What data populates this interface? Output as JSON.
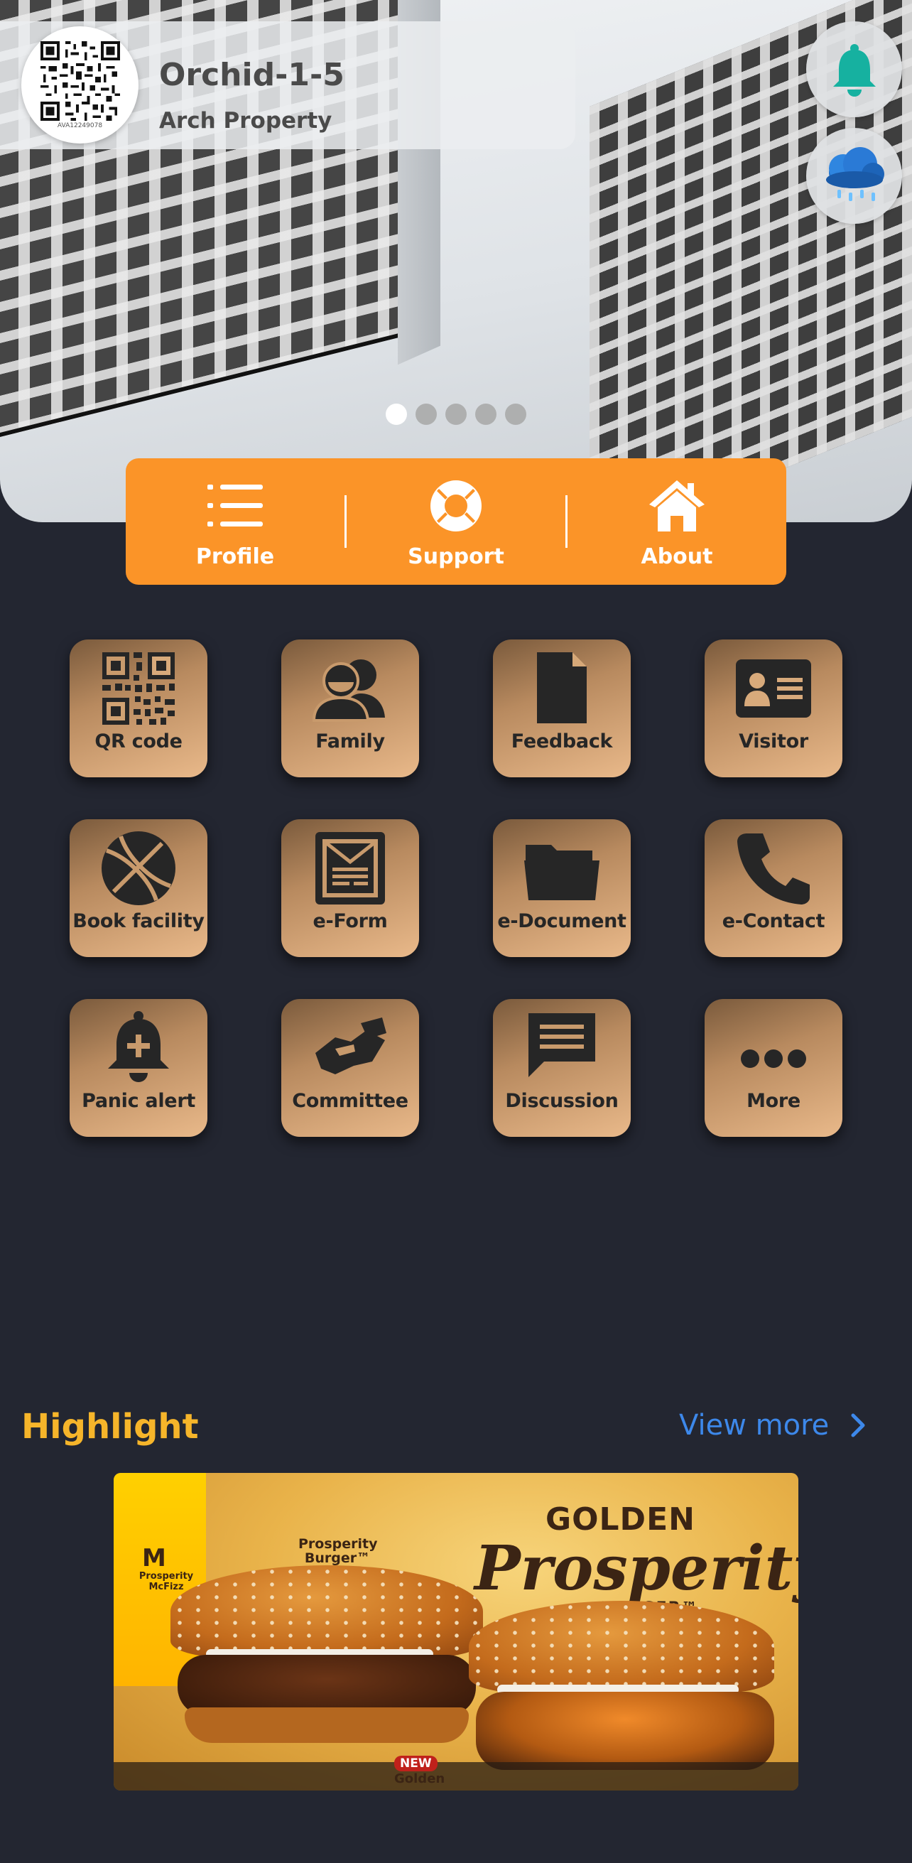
{
  "header": {
    "unit": "Orchid-1-5",
    "property": "Arch Property",
    "qr_caption": "AVA12249078"
  },
  "hero": {
    "slide_count": 5,
    "active_slide": 1
  },
  "nav": [
    {
      "label": "Profile",
      "icon": "list-icon"
    },
    {
      "label": "Support",
      "icon": "lifebuoy-icon"
    },
    {
      "label": "About",
      "icon": "home-icon"
    }
  ],
  "grid": [
    {
      "label": "QR code",
      "icon": "qr-code-icon"
    },
    {
      "label": "Family",
      "icon": "family-icon"
    },
    {
      "label": "Feedback",
      "icon": "document-icon"
    },
    {
      "label": "Visitor",
      "icon": "id-card-icon"
    },
    {
      "label": "Book facility",
      "icon": "basketball-icon"
    },
    {
      "label": "e-Form",
      "icon": "form-icon"
    },
    {
      "label": "e-Document",
      "icon": "folder-icon"
    },
    {
      "label": "e-Contact",
      "icon": "phone-icon"
    },
    {
      "label": "Panic alert",
      "icon": "alert-bell-icon"
    },
    {
      "label": "Committee",
      "icon": "handshake-icon"
    },
    {
      "label": "Discussion",
      "icon": "chat-icon"
    },
    {
      "label": "More",
      "icon": "more-icon"
    }
  ],
  "highlight": {
    "title": "Highlight",
    "view_more": "View more",
    "promo": {
      "line1": "GOLDEN",
      "line2": "Prosperity",
      "line3": "BURGER™",
      "small_label": "Prosperity Burger™",
      "drink_label": "Prosperity McFizz",
      "badge": "NEW",
      "bottom_text": "Golden"
    }
  },
  "colors": {
    "background": "#232631",
    "nav_orange": "#fb9428",
    "highlight_yellow": "#f6b52a",
    "link_blue": "#3d88ea",
    "bell_teal": "#16b1a0"
  }
}
